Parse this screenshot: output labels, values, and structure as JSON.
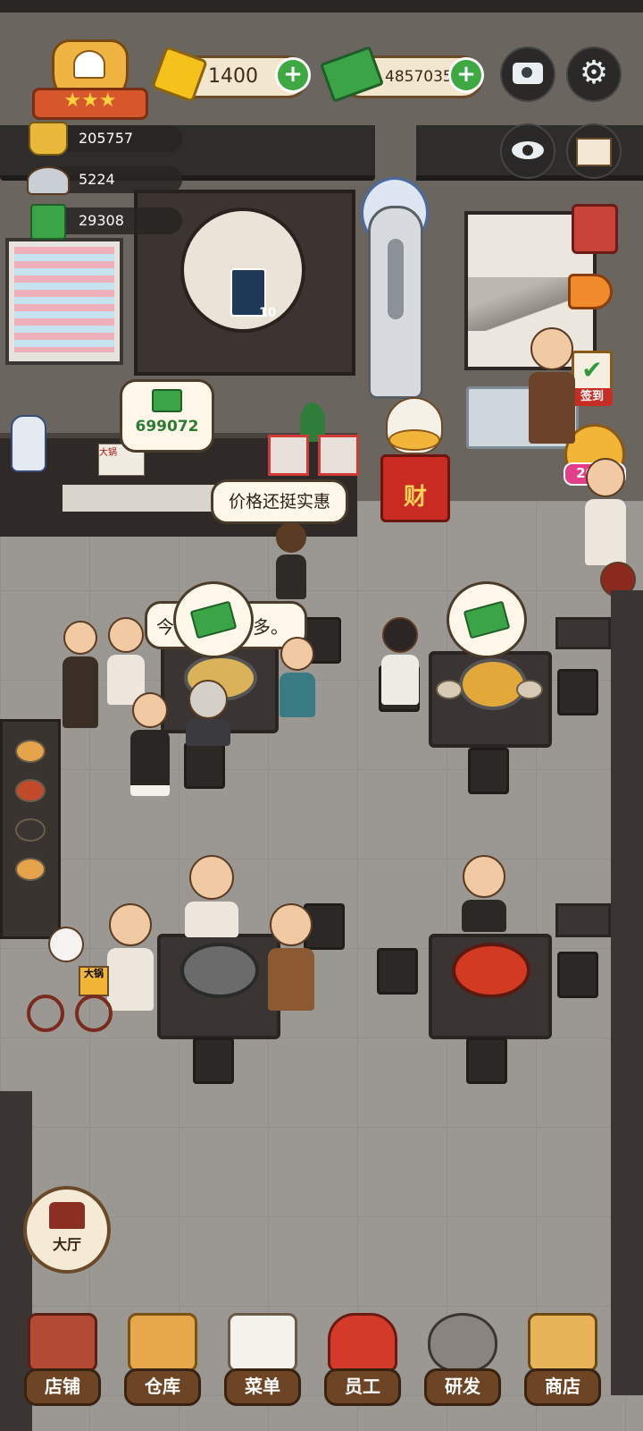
{
  "hud": {
    "stars": 3,
    "gems": "1400",
    "cash": "48570351",
    "stats": [
      "205757",
      "5224",
      "29308"
    ]
  },
  "scene": {
    "tip_amount": "699072",
    "speech_1": "价格还挺实惠",
    "speech_2_start": "今",
    "speech_2_end": "多。",
    "drink_count": "10",
    "fortune_char": "财",
    "shop_sign": "大锅",
    "badge_2022": "2022",
    "signin_label": "签到",
    "newspaper": "大锅"
  },
  "floor_button": {
    "label": "大厅"
  },
  "nav": [
    {
      "label": "店铺",
      "icon": "shop-house-icon"
    },
    {
      "label": "仓库",
      "icon": "warehouse-boxes-icon"
    },
    {
      "label": "菜单",
      "icon": "menu-clipboard-icon"
    },
    {
      "label": "员工",
      "icon": "staff-chef-icon"
    },
    {
      "label": "研发",
      "icon": "research-wok-icon"
    },
    {
      "label": "商店",
      "icon": "store-building-icon"
    }
  ],
  "colors": {
    "plus_green": "#3ea843",
    "nav_brown": "#6e4524",
    "pill": "#f3e6cf"
  }
}
